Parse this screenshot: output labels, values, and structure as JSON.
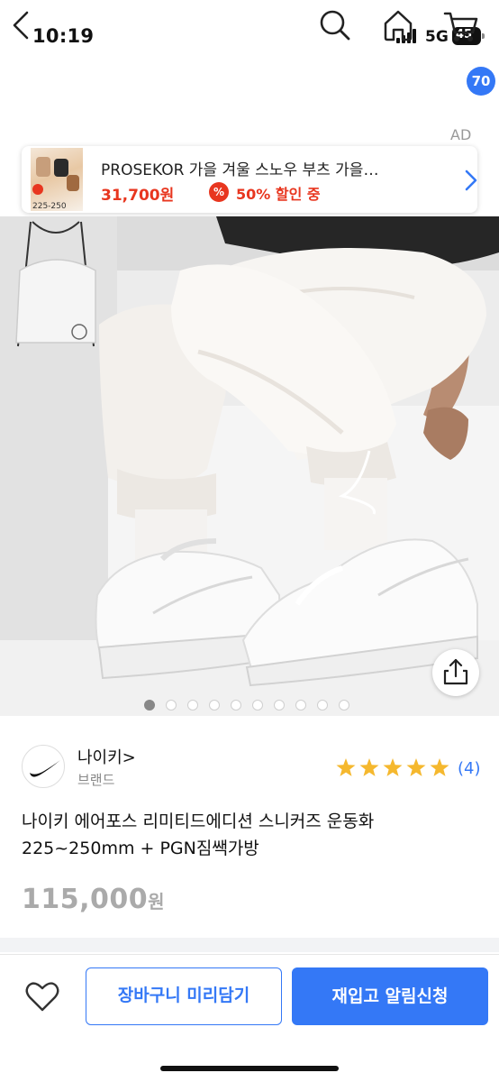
{
  "status_bar": {
    "time": "10:19",
    "network": "5G",
    "battery": "45"
  },
  "nav": {
    "back_icon": "chevron-left-icon",
    "search_icon": "search-icon",
    "home_icon": "home-icon",
    "cart_icon": "cart-icon",
    "cart_count": "70"
  },
  "ad": {
    "label": "AD",
    "title": "PROSEKOR 가을 겨울 스노우 부츠 가을…",
    "price": "31,700원",
    "discount_icon": "%",
    "discount": "50% 할인 중",
    "thumb_size": "225-250"
  },
  "gallery": {
    "page_count": 10,
    "active_index": 0
  },
  "brand": {
    "name": "나이키>",
    "sub": "브랜드",
    "logo_text": "NIKE"
  },
  "rating": {
    "stars": 5,
    "count": "(4)",
    "star_color": "#f5b82e"
  },
  "product": {
    "title": "나이키 에어포스 리미티드에디션 스니커즈 운동화 225~250mm + PGN짐쌕가방",
    "price": "115,000",
    "price_unit": "원"
  },
  "actions": {
    "wish_icon": "heart-icon",
    "add_to_cart": "장바구니 미리담기",
    "restock_alert": "재입고 알림신청"
  },
  "colors": {
    "accent": "#3478f6",
    "sale": "#e8361f"
  }
}
